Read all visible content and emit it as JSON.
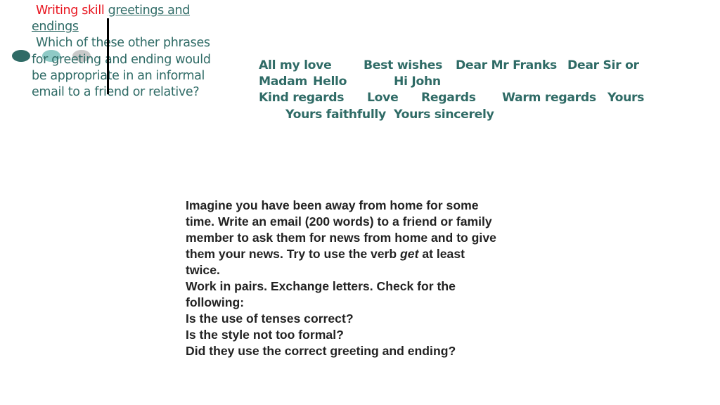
{
  "slide": {
    "title": {
      "prefix": "Writing skill",
      "topic_line1": "greetings and",
      "topic_line2": "endings"
    },
    "question_lines": [
      "Which of these other phrases",
      "for greeting and  ending would",
      "be appropriate in an informal",
      "email  to a friend or relative?"
    ],
    "phrases": [
      "All my love",
      "Best wishes",
      "Dear Mr Franks",
      "Dear Sir or",
      "Madam",
      "Hello",
      "Hi John",
      "Kind regards",
      "Love",
      "Regards",
      "Warm regards",
      "Yours",
      "Yours faithfully",
      "Yours sincerely"
    ],
    "task": {
      "lines_before_em": [
        "Imagine you have been away from home for some",
        "time. Write an email (200 words) to a friend or  family",
        "member to ask them for news from home  and to give"
      ],
      "em_line_prefix": "them your news. Try to use the verb ",
      "em_word": "get",
      "em_line_suffix": "  at least",
      "lines_after_em": [
        "twice.",
        "Work in pairs. Exchange letters. Check for the",
        "following:",
        "Is the use of tenses correct?",
        "Is the style not too formal?",
        "Did they use the correct greeting and ending?"
      ]
    },
    "decor": {
      "bullet_icons": [
        "dark-teal-circle",
        "light-teal-circle",
        "grey-circle"
      ],
      "colors": {
        "teal_text": "#2f6b66",
        "title_red": "#e8141e",
        "body_text": "#222222"
      }
    }
  }
}
